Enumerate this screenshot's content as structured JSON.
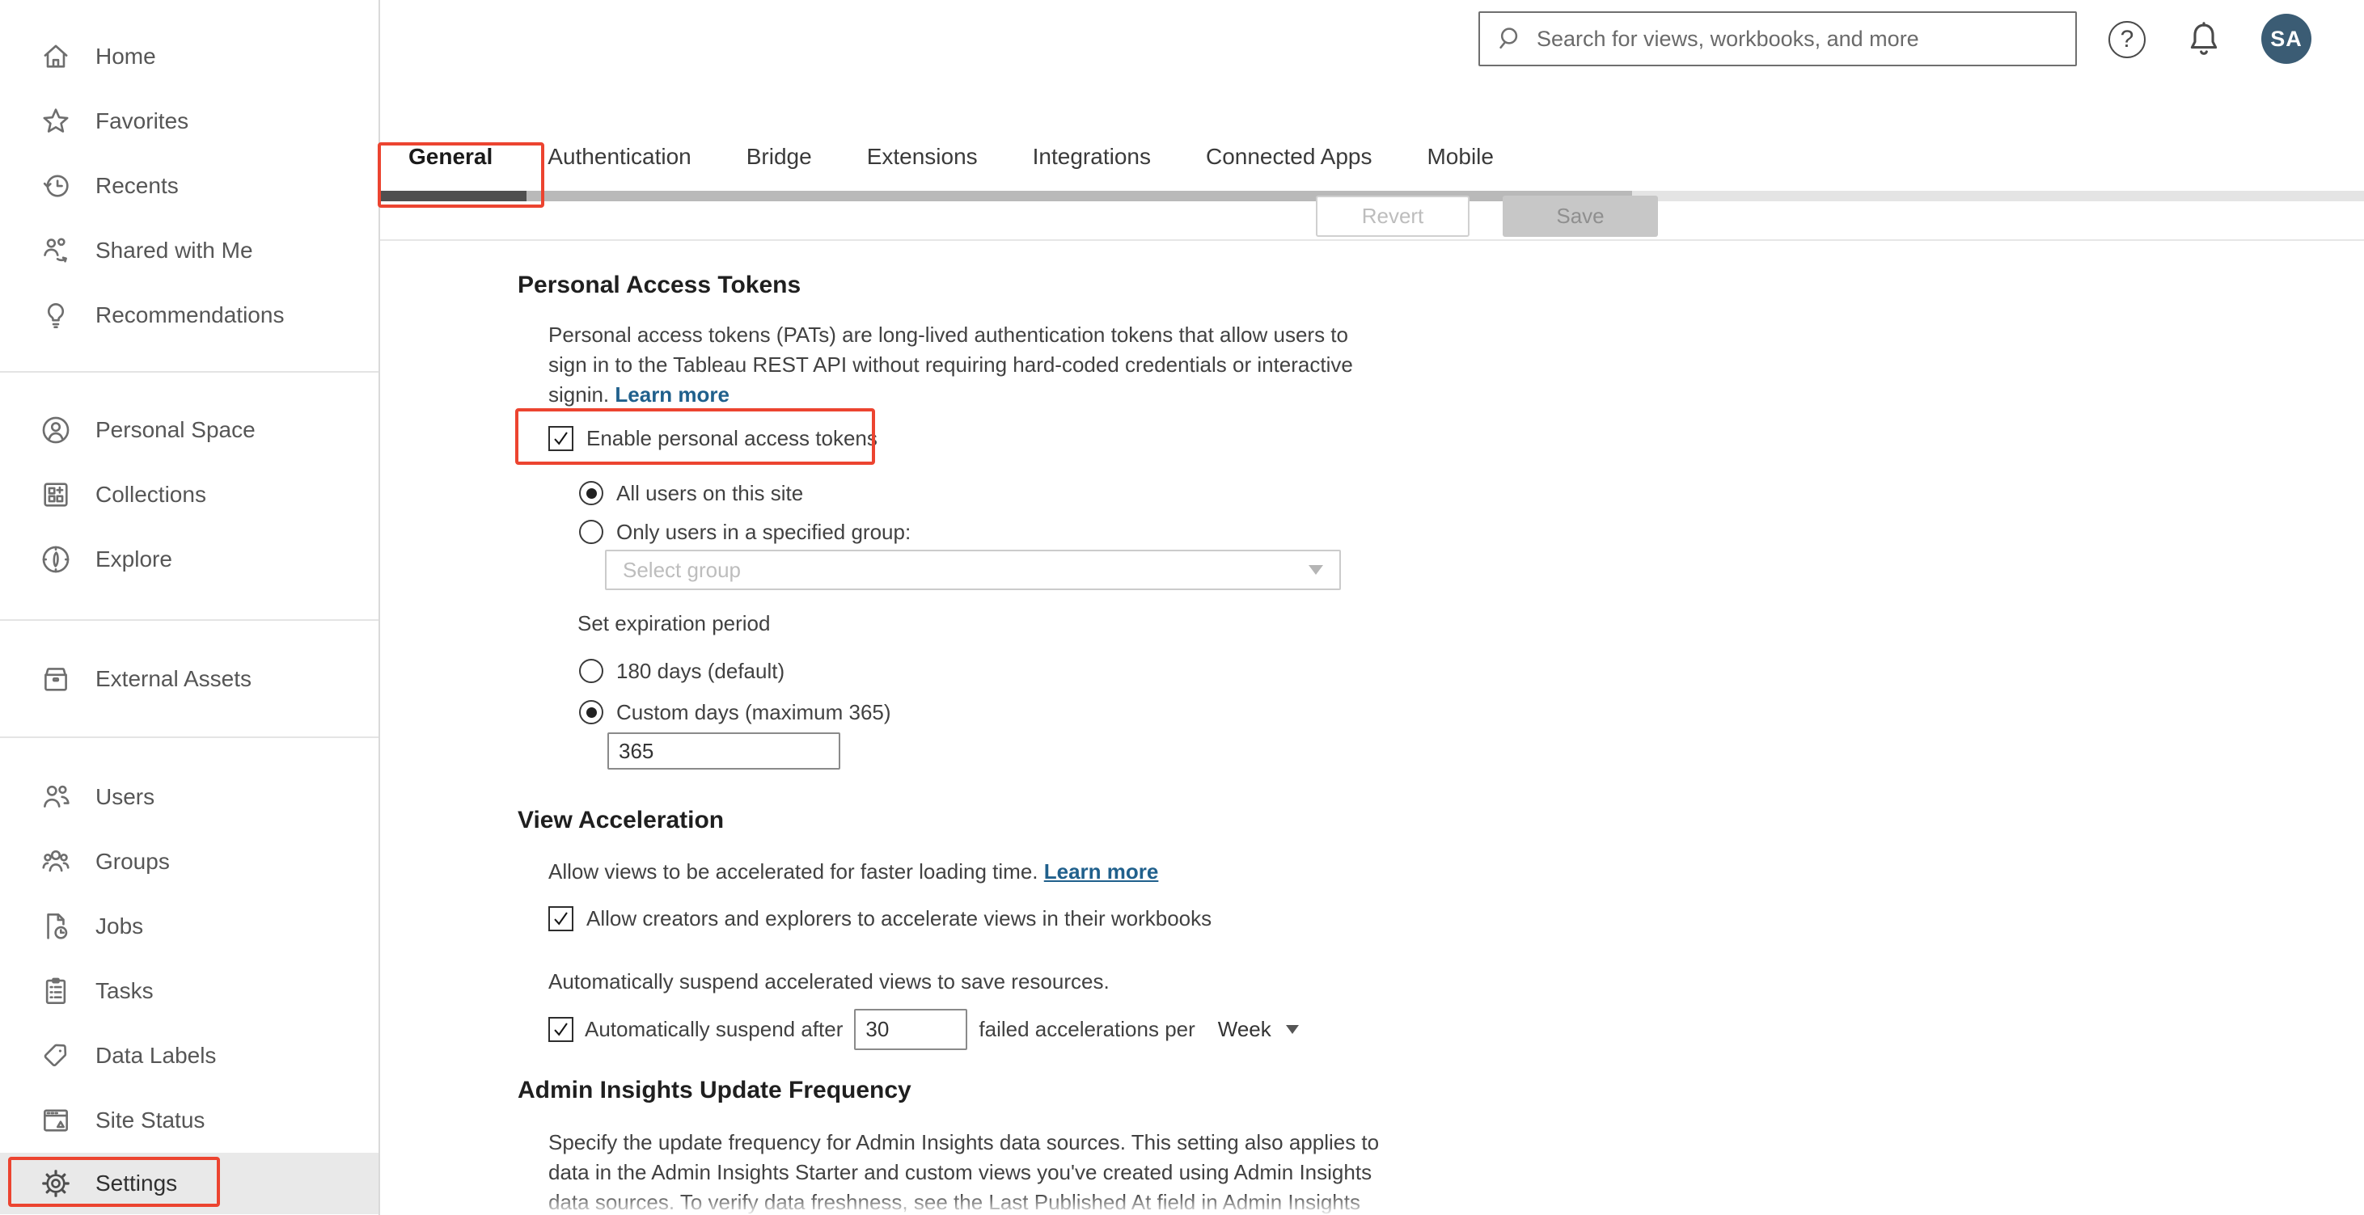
{
  "colors": {
    "annotation_red": "#ec4430",
    "link_blue": "#20608c",
    "avatar_bg": "#3b5c74",
    "tab_indicator_dark": "#4f4f4f",
    "scrollbar_thumb": "#b9b9b9",
    "scrollbar_track": "#e4e4e4",
    "settings_row_bg": "#e9e9e9"
  },
  "topbar": {
    "search_placeholder": "Search for views, workbooks, and more",
    "help_glyph": "?",
    "avatar_initials": "SA"
  },
  "sidebar": {
    "items_main": [
      {
        "icon": "home-icon",
        "label": "Home"
      },
      {
        "icon": "star-icon",
        "label": "Favorites"
      },
      {
        "icon": "recents-icon",
        "label": "Recents"
      },
      {
        "icon": "shared-with-me-icon",
        "label": "Shared with Me"
      },
      {
        "icon": "lightbulb-icon",
        "label": "Recommendations"
      }
    ],
    "items_personal": [
      {
        "icon": "person-circle-icon",
        "label": "Personal Space"
      },
      {
        "icon": "collections-icon",
        "label": "Collections"
      },
      {
        "icon": "compass-icon",
        "label": "Explore"
      }
    ],
    "items_assets": [
      {
        "icon": "archive-box-icon",
        "label": "External Assets"
      }
    ],
    "items_admin": [
      {
        "icon": "users-icon",
        "label": "Users"
      },
      {
        "icon": "groups-icon",
        "label": "Groups"
      },
      {
        "icon": "jobs-icon",
        "label": "Jobs"
      },
      {
        "icon": "tasks-icon",
        "label": "Tasks"
      },
      {
        "icon": "tag-icon",
        "label": "Data Labels"
      },
      {
        "icon": "site-status-icon",
        "label": "Site Status"
      }
    ],
    "settings_label": "Settings"
  },
  "tabs": [
    "General",
    "Authentication",
    "Bridge",
    "Extensions",
    "Integrations",
    "Connected Apps",
    "Mobile"
  ],
  "toolbar": {
    "revert_label": "Revert",
    "save_label": "Save"
  },
  "sections": {
    "pat": {
      "title": "Personal Access Tokens",
      "description": "Personal access tokens (PATs) are long-lived authentication tokens that allow users to\nsign in to the Tableau REST API without requiring hard-coded credentials or interactive\nsignin.",
      "learn_more": "Learn more",
      "enable_label": "Enable personal access tokens",
      "radio_all_users": "All users on this site",
      "radio_specified_group": "Only users in a specified group:",
      "select_group_placeholder": "Select group",
      "expiration_label": "Set expiration period",
      "radio_180_days": "180 days (default)",
      "radio_custom_days": "Custom days (maximum 365)",
      "custom_days_value": "365"
    },
    "view_acceleration": {
      "title": "View Acceleration",
      "description": "Allow views to be accelerated for faster loading time.",
      "learn_more": "Learn more",
      "allow_label": "Allow creators and explorers to accelerate views in their workbooks",
      "suspend_description": "Automatically suspend accelerated views to save resources.",
      "suspend_label_before": "Automatically suspend after",
      "suspend_value": "30",
      "suspend_label_after": "failed accelerations per",
      "suspend_period": "Week"
    },
    "admin_insights": {
      "title": "Admin Insights Update Frequency",
      "description": "Specify the update frequency for Admin Insights data sources. This setting also applies to\ndata in the Admin Insights Starter and custom views you've created using Admin Insights\ndata sources. To verify data freshness, see the Last Published At field in Admin Insights"
    }
  }
}
